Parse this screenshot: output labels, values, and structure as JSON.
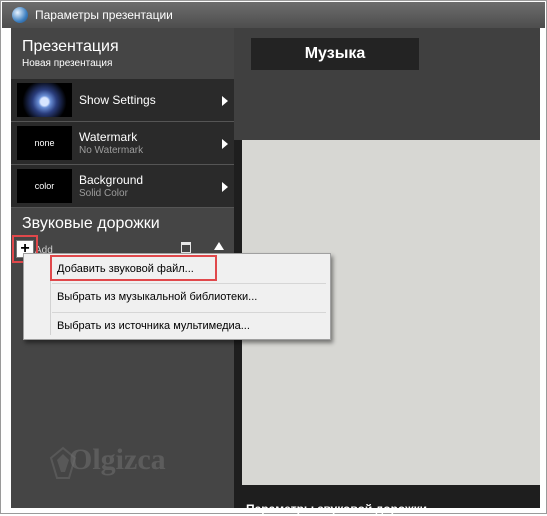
{
  "window": {
    "title": "Параметры презентации"
  },
  "sidebar": {
    "presentation_heading": "Презентация",
    "presentation_name": "Новая презентация",
    "rows": [
      {
        "label": "Show Settings",
        "sublabel": "",
        "thumb": ""
      },
      {
        "label": "Watermark",
        "sublabel": "No Watermark",
        "thumb": "none"
      },
      {
        "label": "Background",
        "sublabel": "Solid Color",
        "thumb": "color"
      }
    ],
    "tracks_heading": "Звуковые дорожки",
    "add_label": "Add"
  },
  "main": {
    "tab_label": "Музыка",
    "bottom_label": "Параметры звуковой дорожки"
  },
  "context_menu": {
    "items": [
      "Добавить звуковой файл...",
      "Выбрать из музыкальной библиотеки...",
      "Выбрать из источника мультимедиа..."
    ]
  },
  "watermark_text": "Olgizca",
  "colors": {
    "highlight": "#e0484b",
    "content_bg": "#d7d7d3",
    "sidebar_bg": "#454545"
  },
  "icons": [
    "app-icon",
    "add-icon",
    "trash-icon",
    "up-arrow-icon",
    "chevron-right-icon"
  ]
}
